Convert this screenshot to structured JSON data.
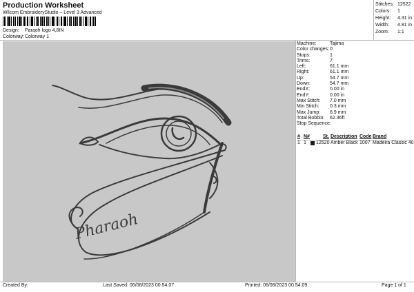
{
  "header": {
    "title": "Production Worksheet",
    "subtitle": "Wilcom EmbroideryStudio – Level 3 Advanced"
  },
  "meta": {
    "design_label": "Design:",
    "design_value": "Paraoh logo 4,8IN",
    "colorway_label": "Colorway:",
    "colorway_value": "Colorway 1"
  },
  "stats": [
    {
      "label": "Stitches:",
      "value": "12522"
    },
    {
      "label": "Colors:",
      "value": "1"
    },
    {
      "label": "Height:",
      "value": "4.31 in"
    },
    {
      "label": "Width:",
      "value": "4.81 in"
    },
    {
      "label": "Zoom:",
      "value": "1:1"
    }
  ],
  "details": [
    {
      "label": "Machine:",
      "value": "Tajima"
    },
    {
      "label": "Color changes:",
      "value": "0"
    },
    {
      "label": "Stops:",
      "value": "1"
    },
    {
      "label": "Trims:",
      "value": "7"
    },
    {
      "label": "Left:",
      "value": "61.1 mm"
    },
    {
      "label": "Right:",
      "value": "61.1 mm"
    },
    {
      "label": "Up:",
      "value": "54.7 mm"
    },
    {
      "label": "Down:",
      "value": "54.7 mm"
    },
    {
      "label": "EndX:",
      "value": "0.00 in"
    },
    {
      "label": "EndY:",
      "value": "0.00 in"
    },
    {
      "label": "Max Stitch:",
      "value": "7.0 mm"
    },
    {
      "label": "Min Stitch:",
      "value": "0.3 mm"
    },
    {
      "label": "Max Jump:",
      "value": "6.9 mm"
    },
    {
      "label": "Total Bobbin:",
      "value": "62.36ft"
    }
  ],
  "stop_sequence": {
    "title": "Stop Sequence:",
    "headers": [
      "#",
      "N#",
      "St.",
      "Description",
      "Code",
      "Brand"
    ],
    "rows": [
      {
        "num": "1",
        "n": "1",
        "color": "#1a1a1a",
        "stitches": "12520",
        "description": "Amber Black",
        "code": "1007",
        "brand": "Madeira Classic 40"
      }
    ]
  },
  "design_text": "Pharaoh",
  "colors": {
    "background": "#c8c8c8",
    "thread": "#3a3a3a"
  },
  "footer": {
    "created_by": "Created By:",
    "last_saved": "Last Saved: 06/08/2023 00.54.07",
    "printed": "Printed: 06/08/2023 00.54.09",
    "page": "Page 1 of 1"
  }
}
